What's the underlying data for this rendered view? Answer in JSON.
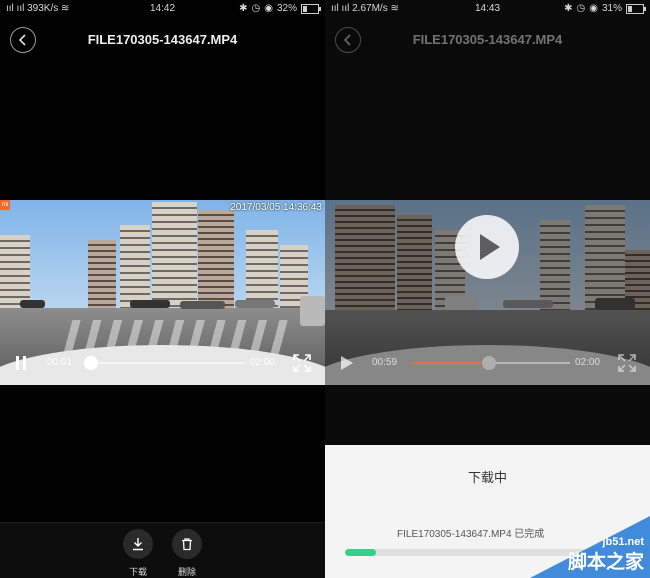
{
  "left": {
    "statusbar": {
      "signal": "ᯤ",
      "net_speed": "393K/s",
      "time": "14:42",
      "battery": "32%",
      "battery_level": 0.32
    },
    "title": "FILE170305-143647.MP4",
    "video": {
      "timestamp": "2017/03/05 14:36:43",
      "current": "00:01",
      "duration": "02:00",
      "progress": 0.03,
      "badge": "mi"
    },
    "actions": {
      "download": "下载",
      "delete": "删除"
    }
  },
  "right": {
    "statusbar": {
      "signal": "ᯤ",
      "net_speed": "2.67M/s",
      "time": "14:43",
      "battery": "31%",
      "battery_level": 0.31
    },
    "title": "FILE170305-143647.MP4",
    "video": {
      "current": "00:59",
      "duration": "02:00",
      "progress": 0.49
    },
    "download": {
      "title": "下载中",
      "file_text": "FILE170305-143647.MP4 已完成",
      "progress": 0.12
    }
  },
  "watermark": {
    "url": "jb51.net",
    "text": "脚本之家"
  }
}
